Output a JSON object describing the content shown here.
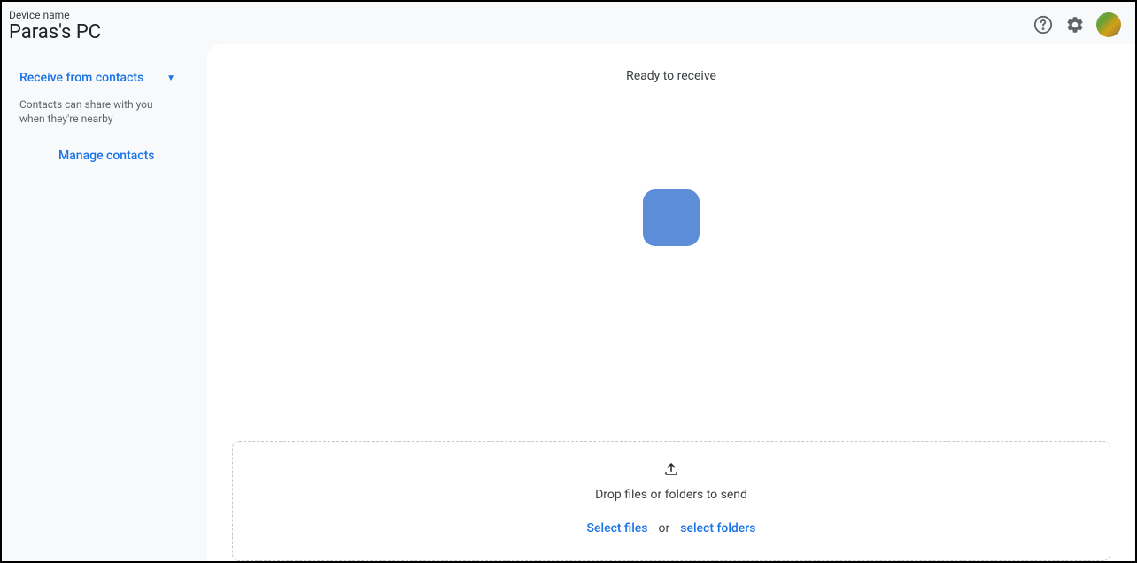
{
  "header": {
    "device_label": "Device name",
    "device_name": "Paras's PC"
  },
  "sidebar": {
    "receive_label": "Receive from contacts",
    "receive_description": "Contacts can share with you when they're nearby",
    "manage_link": "Manage contacts"
  },
  "main": {
    "status": "Ready to receive",
    "drop_text": "Drop files or folders to send",
    "select_files": "Select files",
    "or_text": "or",
    "select_folders": "select folders"
  }
}
